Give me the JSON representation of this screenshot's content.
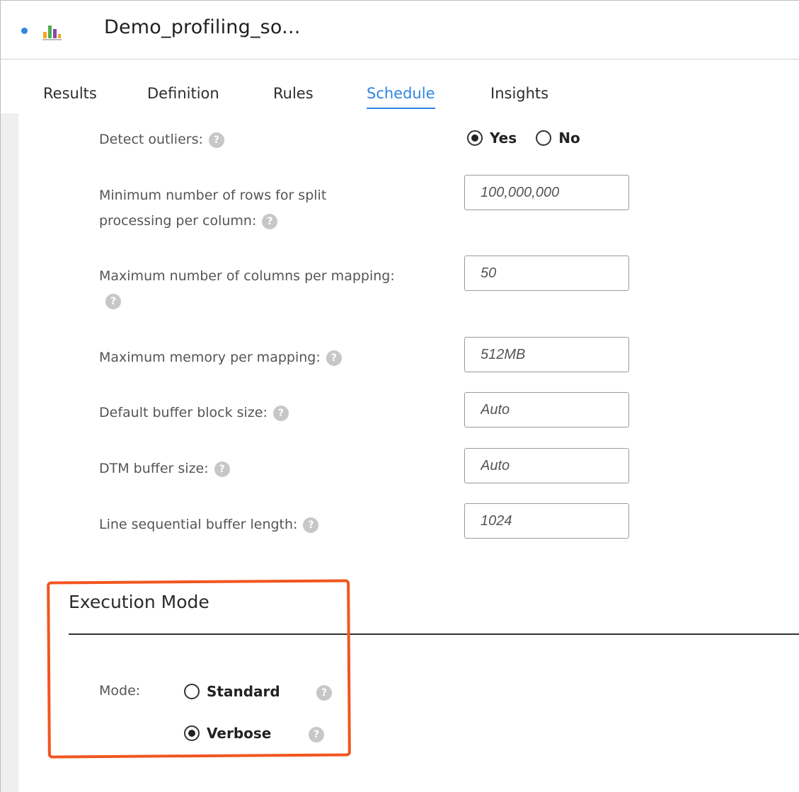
{
  "header": {
    "title": "Demo_profiling_so...",
    "status_dot_color": "#2f86e0",
    "icon": "bar-chart-icon"
  },
  "tabs": [
    {
      "label": "Results",
      "active": false
    },
    {
      "label": "Definition",
      "active": false
    },
    {
      "label": "Rules",
      "active": false
    },
    {
      "label": "Schedule",
      "active": true
    },
    {
      "label": "Insights",
      "active": false
    }
  ],
  "settings": {
    "detect_outliers": {
      "label": "Detect outliers:",
      "options": [
        "Yes",
        "No"
      ],
      "selected": "Yes"
    },
    "min_rows_split": {
      "label_line1": "Minimum number of rows for split",
      "label_line2": "processing per column:",
      "value": "100,000,000"
    },
    "max_columns": {
      "label": "Maximum number of columns per mapping:",
      "value": "50"
    },
    "max_memory": {
      "label": "Maximum memory per mapping:",
      "value": "512MB"
    },
    "default_buffer_block": {
      "label": "Default buffer block size:",
      "value": "Auto"
    },
    "dtm_buffer": {
      "label": "DTM buffer size:",
      "value": "Auto"
    },
    "line_sequential_buffer": {
      "label": "Line sequential buffer length:",
      "value": "1024"
    }
  },
  "execution_mode": {
    "title": "Execution Mode",
    "mode_label": "Mode:",
    "options": [
      "Standard",
      "Verbose"
    ],
    "selected": "Verbose",
    "highlight_color": "#f2551f"
  },
  "help_glyph": "?"
}
